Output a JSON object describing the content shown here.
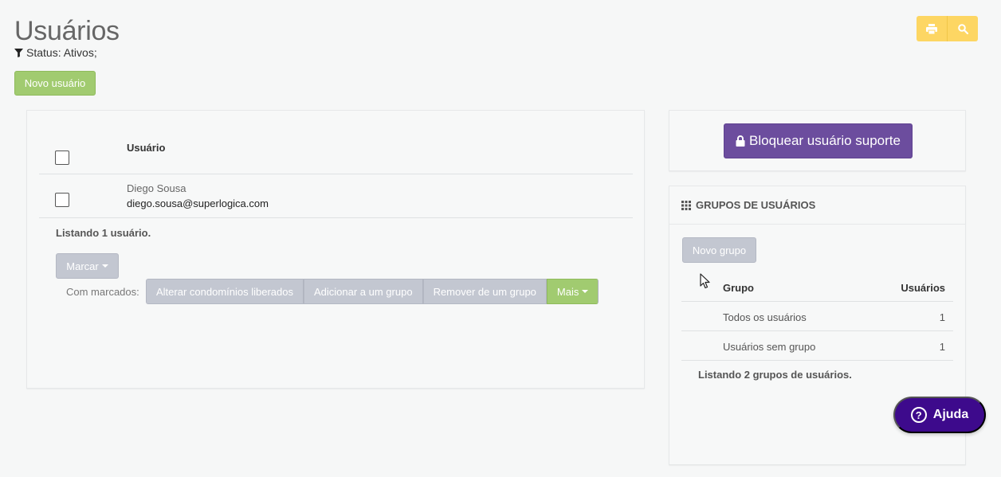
{
  "header": {
    "title": "Usuários",
    "filter_text": "Status: Ativos;",
    "new_user_label": "Novo usuário"
  },
  "top_actions": {
    "icons": [
      "print-icon",
      "search-icon"
    ],
    "color": "#fdd663"
  },
  "users_table": {
    "column_header": "Usuário",
    "rows": [
      {
        "name": "Diego Sousa",
        "email": "diego.sousa@superlogica.com"
      }
    ],
    "listing_text": "Listando 1 usuário.",
    "mark_label": "Marcar",
    "with_marked_label": "Com marcados:",
    "bulk_actions": [
      "Alterar condomínios liberados",
      "Adicionar a um grupo",
      "Remover de um grupo"
    ],
    "more_label": "Mais"
  },
  "support": {
    "lock_label": "Bloquear usuário suporte"
  },
  "groups": {
    "title": "GRUPOS DE USUÁRIOS",
    "new_group_label": "Novo grupo",
    "col_group": "Grupo",
    "col_users": "Usuários",
    "rows": [
      {
        "name": "Todos os usuários",
        "count": "1"
      },
      {
        "name": "Usuários sem grupo",
        "count": "1"
      }
    ],
    "listing_text": "Listando 2 grupos de usuários."
  },
  "help": {
    "label": "Ajuda"
  },
  "colors": {
    "green": "#a1cb70",
    "gray": "#c3c7d1",
    "purple": "#6c4d9e",
    "help": "#3d0a8c"
  }
}
